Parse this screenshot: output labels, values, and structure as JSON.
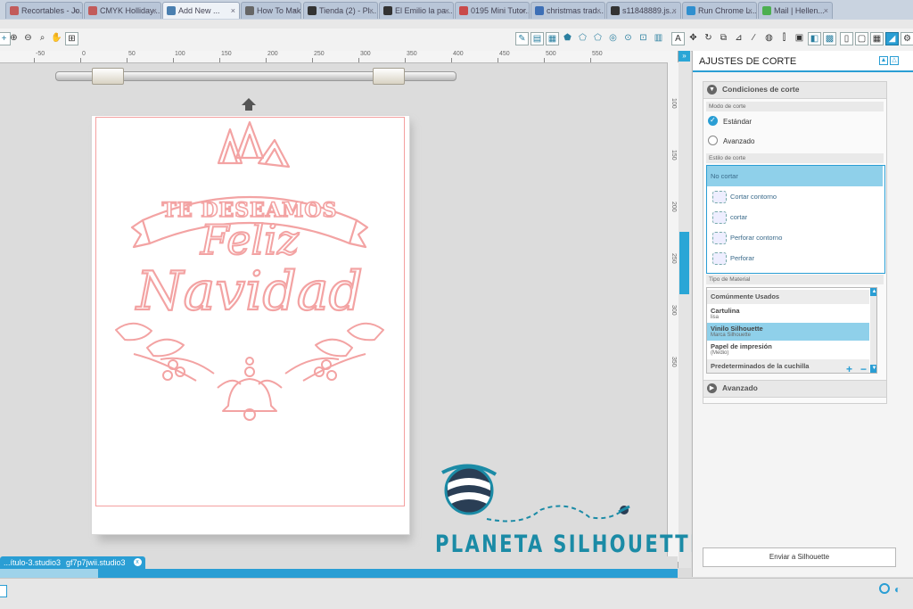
{
  "browser_tabs": [
    {
      "title": "Recortables - Jo...",
      "color": "#c25b5b"
    },
    {
      "title": "CMYK Holliday...",
      "color": "#c25b5b"
    },
    {
      "title": "Add New ...",
      "color": "#4a7fb0"
    },
    {
      "title": "How To Make a...",
      "color": "#666666"
    },
    {
      "title": "Tienda (2) - Pl...",
      "color": "#333333"
    },
    {
      "title": "El Emilio la pa...",
      "color": "#333333"
    },
    {
      "title": "0195 Mini Tutor...",
      "color": "#c94a4a"
    },
    {
      "title": "christmas trad...",
      "color": "#3d6fb6"
    },
    {
      "title": "s11848889.js...",
      "color": "#333333"
    },
    {
      "title": "Run Chrome L...",
      "color": "#2f8fcf"
    },
    {
      "title": "Mail | Hellen...",
      "color": "#4caf50"
    }
  ],
  "ruler": {
    "top_ticks": [
      "-50",
      "0",
      "50",
      "100",
      "150",
      "200",
      "250",
      "300",
      "350",
      "400",
      "450",
      "500",
      "550"
    ],
    "right_ticks": [
      "100",
      "150",
      "200",
      "250",
      "300",
      "350"
    ]
  },
  "doc_tabs": [
    "...ítulo-3.studio3",
    "gf7p7jwii.studio3"
  ],
  "panel": {
    "title": "AJUSTES DE CORTE",
    "conditions_title": "Condiciones de corte",
    "mode_label": "Modo de corte",
    "mode_options": [
      {
        "label": "Estándar",
        "selected": true
      },
      {
        "label": "Avanzado",
        "selected": false
      }
    ],
    "style_label": "Estilo de corte",
    "style_options": [
      {
        "label": "No cortar",
        "selected": true
      },
      {
        "label": "Cortar contorno",
        "selected": false
      },
      {
        "label": "cortar",
        "selected": false
      },
      {
        "label": "Perforar contorno",
        "selected": false
      },
      {
        "label": "Perforar",
        "selected": false
      }
    ],
    "material_label": "Tipo de Material",
    "material_group_common": "Comúnmente Usados",
    "materials": [
      {
        "name": "Cartulina",
        "sub": "lisa",
        "selected": false
      },
      {
        "name": "Vinilo Silhouette",
        "sub": "Marca Silhouette",
        "selected": true
      },
      {
        "name": "Papel de impresión",
        "sub": "(Medio)",
        "selected": false
      }
    ],
    "material_group_blade": "Predeterminados de la cuchilla",
    "add_label": "+",
    "remove_label": "−",
    "advanced_title": "Avanzado",
    "send_button": "Enviar a Silhouette"
  },
  "design": {
    "banner_text": "TE DESEAMOS",
    "line1": "Feliz",
    "line2": "Navidad",
    "color": "#f3a3a3"
  },
  "watermark": {
    "text": "PLANETA SILHOUETTE",
    "color": "#1b8ba6"
  },
  "colors": {
    "accent": "#2a9ed4",
    "selection": "#8fd0ea"
  }
}
